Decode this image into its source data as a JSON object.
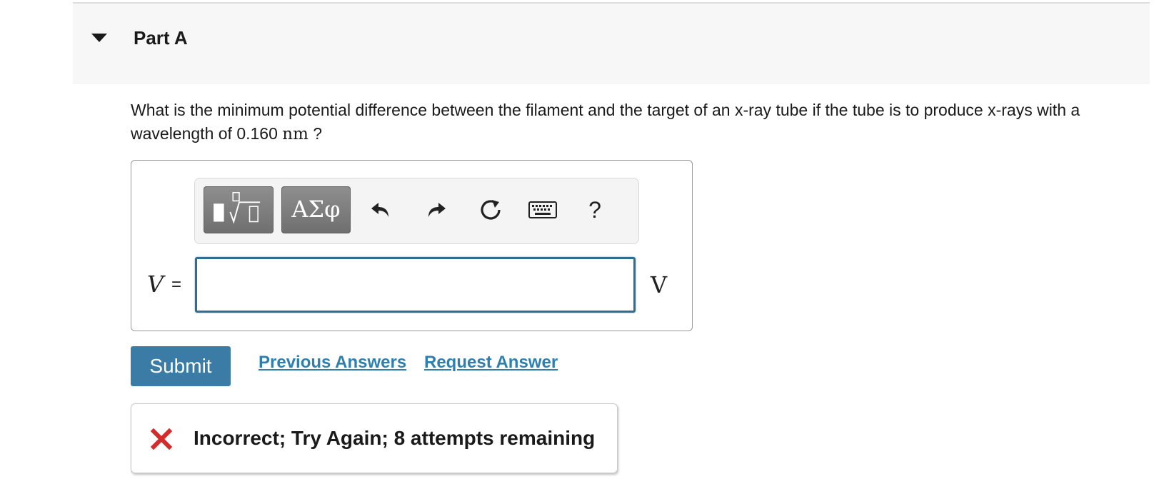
{
  "part": {
    "title": "Part A"
  },
  "question": {
    "text": "What is the minimum potential difference between the filament and the target of an x-ray tube if the tube is to produce x-rays with a wavelength of 0.160 ",
    "unit": "nm",
    "suffix": " ?"
  },
  "toolbar": {
    "greek_label": "ΑΣφ",
    "help_label": "?"
  },
  "answer": {
    "variable": "V",
    "equals": "=",
    "value": "",
    "unit": "V"
  },
  "actions": {
    "submit_label": "Submit",
    "previous_answers_label": "Previous Answers",
    "request_answer_label": "Request Answer"
  },
  "feedback": {
    "text": "Incorrect; Try Again; 8 attempts remaining",
    "icon": "x-mark-icon",
    "color": "#d42b2b"
  },
  "colors": {
    "accent": "#3a7ca5",
    "link": "#2e7fb0",
    "input_border": "#2f6e94"
  }
}
